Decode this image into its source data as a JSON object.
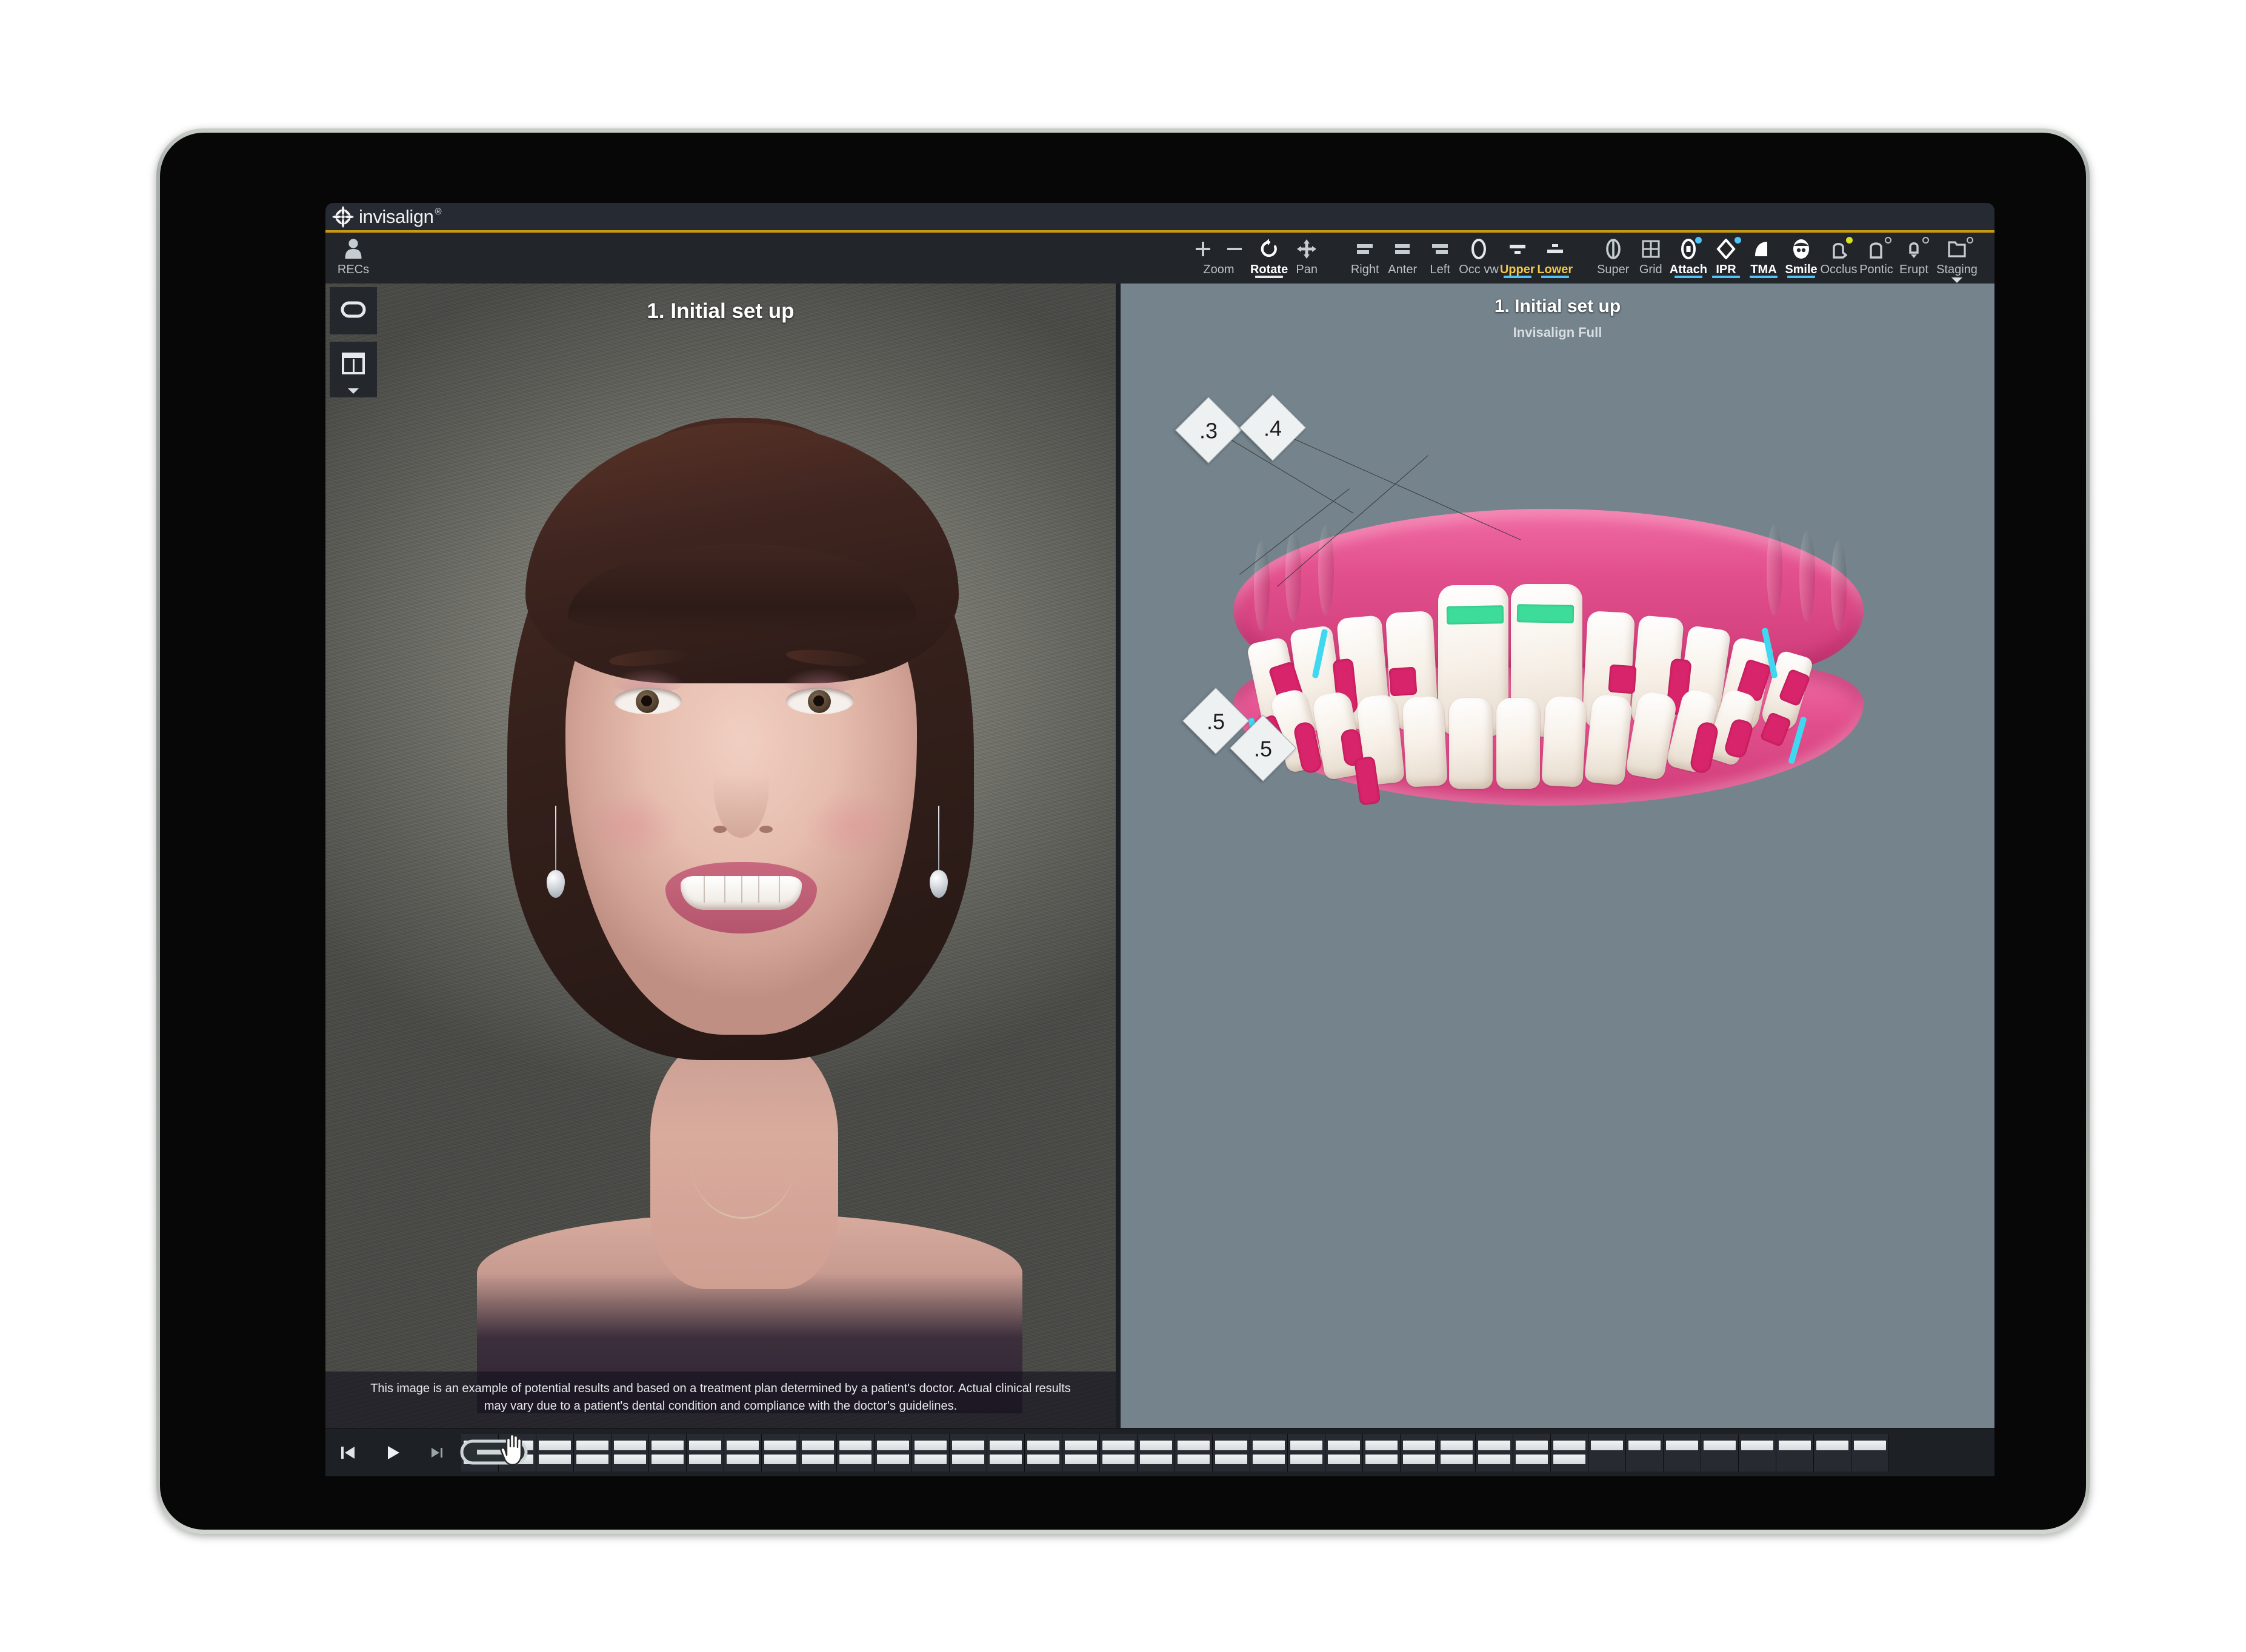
{
  "app": {
    "brand_name": "invisalign",
    "brand_tm": "®",
    "brand_icon": "asterisk-starburst-icon",
    "accent_gold": "#c79a13",
    "accent_cyan": "#4fc3f7",
    "viewport_bg": "#74838c"
  },
  "toolbar": {
    "recs": {
      "label": "RECs",
      "icon": "person-icon",
      "active": false
    },
    "zoom": {
      "label": "Zoom",
      "plus_icon": "plus-icon",
      "minus_icon": "minus-icon",
      "active": false
    },
    "view_group": [
      {
        "label": "Rotate",
        "icon": "rotate-icon",
        "active": true,
        "underline": "white",
        "badge": null
      },
      {
        "label": "Pan",
        "icon": "move-arrows-icon",
        "active": false,
        "underline": null,
        "badge": null
      }
    ],
    "orientation_group": [
      {
        "label": "Right",
        "icon": "view-right-icon",
        "active": false,
        "underline": null,
        "badge": null
      },
      {
        "label": "Anter",
        "icon": "view-anterior-icon",
        "active": false,
        "underline": null,
        "badge": null
      },
      {
        "label": "Left",
        "icon": "view-left-icon",
        "active": false,
        "underline": null,
        "badge": null
      },
      {
        "label": "Occ vw",
        "icon": "occlusal-view-icon",
        "active": false,
        "underline": null,
        "badge": null
      },
      {
        "label": "Upper",
        "icon": "upper-arch-icon",
        "active": true,
        "underline": "cyan",
        "badge": null
      },
      {
        "label": "Lower",
        "icon": "lower-arch-icon",
        "active": true,
        "underline": "cyan",
        "badge": null
      }
    ],
    "feature_group": [
      {
        "label": "Super",
        "icon": "superimpose-icon",
        "active": false,
        "underline": null,
        "badge": null
      },
      {
        "label": "Grid",
        "icon": "grid-icon",
        "active": false,
        "underline": null,
        "badge": null
      },
      {
        "label": "Attach",
        "icon": "attachment-icon",
        "active": true,
        "underline": "cyan",
        "badge": "cyan-dot"
      },
      {
        "label": "IPR",
        "icon": "ipr-diamond-icon",
        "active": true,
        "underline": "cyan",
        "badge": "cyan-dot"
      },
      {
        "label": "TMA",
        "icon": "tma-arch-icon",
        "active": true,
        "underline": "cyan",
        "badge": null
      },
      {
        "label": "Smile",
        "icon": "smile-icon",
        "active": true,
        "underline": "cyan",
        "badge": null
      },
      {
        "label": "Occlus",
        "icon": "occlusion-icon",
        "active": false,
        "underline": null,
        "badge": "yellow-dot"
      },
      {
        "label": "Pontic",
        "icon": "pontic-icon",
        "active": false,
        "underline": null,
        "badge": "ring"
      },
      {
        "label": "Erupt",
        "icon": "eruption-icon",
        "active": false,
        "underline": null,
        "badge": "ring"
      },
      {
        "label": "Staging",
        "icon": "staging-folder-icon",
        "active": false,
        "underline": null,
        "badge": "ring",
        "has_dropdown": true
      }
    ]
  },
  "left_sidebar": [
    {
      "name": "oval-tool",
      "icon": "oval-outline-icon",
      "has_dropdown": false
    },
    {
      "name": "layout-tool",
      "icon": "split-panel-icon",
      "has_dropdown": true
    }
  ],
  "left_panel": {
    "title": "1. Initial set up",
    "disclaimer": "This image is an example of potential results and based on a treatment plan determined by a patient's doctor. Actual clinical results may vary due to a patient's dental condition and compliance with the doctor's guidelines."
  },
  "right_panel": {
    "title": "1. Initial set up",
    "subtitle": "Invisalign Full",
    "ipr_measurements": [
      {
        "value": ".3",
        "position": "upper-left"
      },
      {
        "value": ".4",
        "position": "upper-right"
      },
      {
        "value": ".5",
        "position": "lower-left"
      },
      {
        "value": ".5",
        "position": "lower-right"
      }
    ]
  },
  "transport": {
    "buttons": [
      {
        "name": "skip-to-start-button",
        "icon": "skip-start-icon"
      },
      {
        "name": "play-button",
        "icon": "play-icon"
      },
      {
        "name": "skip-to-end-button",
        "icon": "skip-end-icon"
      }
    ],
    "current_stage": 1,
    "total_stages": 38,
    "lower_stages": 30,
    "cursor": "hand-cursor"
  }
}
